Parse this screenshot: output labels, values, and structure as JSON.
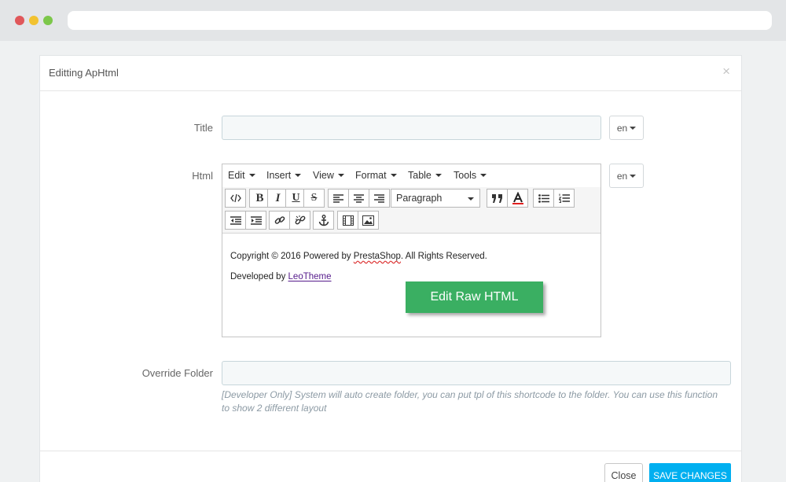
{
  "modal": {
    "title": "Editting ApHtml",
    "close_glyph": "×"
  },
  "form": {
    "title_label": "Title",
    "title_value": "",
    "title_lang": "en",
    "html_label": "Html",
    "html_lang": "en",
    "override_label": "Override Folder",
    "override_value": "",
    "override_help": "[Developer Only] System will auto create folder, you can put tpl of this shortcode to the folder. You can use this function to show 2 different layout"
  },
  "editor": {
    "menu": [
      "Edit",
      "Insert",
      "View",
      "Format",
      "Table",
      "Tools"
    ],
    "format_select": "Paragraph",
    "toolbar_icons": [
      "code-icon",
      "bold-icon",
      "italic-icon",
      "underline-icon",
      "strikethrough-icon",
      "align-left-icon",
      "align-center-icon",
      "align-right-icon",
      "blockquote-icon",
      "text-color-icon",
      "bullet-list-icon",
      "numbered-list-icon",
      "outdent-icon",
      "indent-icon",
      "link-icon",
      "unlink-icon",
      "anchor-icon",
      "media-icon",
      "image-icon"
    ],
    "content": {
      "line1_prefix": "Copyright © 2016 Powered by ",
      "line1_brand": "PrestaShop",
      "line1_suffix": ". All Rights Reserved.",
      "line2_prefix": "Developed by ",
      "line2_link": "LeoTheme"
    },
    "raw_button": "Edit Raw HTML"
  },
  "footer": {
    "close_label": "Close",
    "save_label": "SAVE CHANGES"
  },
  "colors": {
    "accent": "#00aff0",
    "raw_button": "#3aaf62"
  }
}
